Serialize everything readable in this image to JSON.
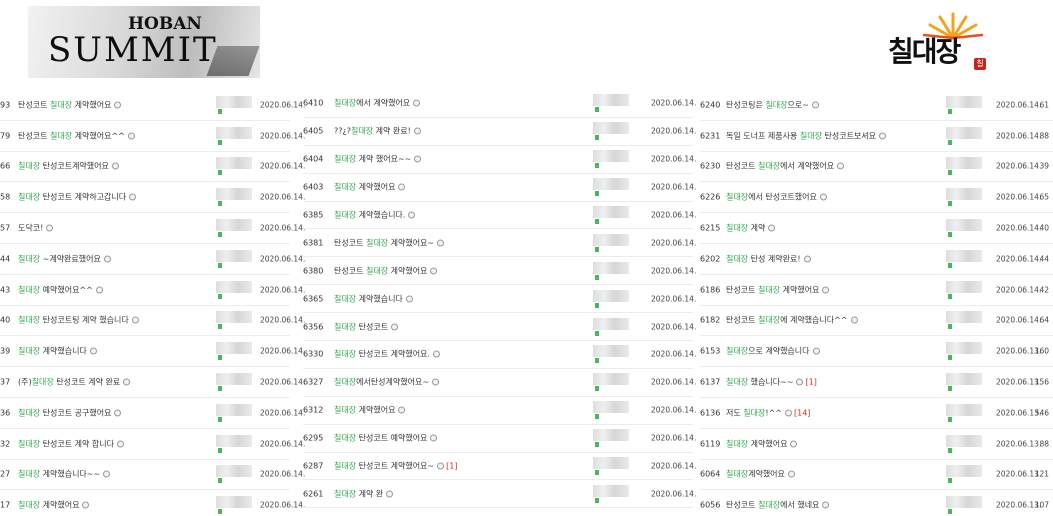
{
  "logos": {
    "left_top": "HOBAN",
    "left_bottom": "SUMMIT",
    "right": "칠대장",
    "right_seal": "칠"
  },
  "columns": [
    {
      "rows": [
        {
          "num": "93",
          "pre": "탄성코트 ",
          "hl": "칠대장",
          "post": " 계약했어요",
          "date": "2020.06.14."
        },
        {
          "num": "79",
          "pre": "탄성코트 ",
          "hl": "칠대장",
          "post": " 계약했어요^^",
          "date": "2020.06.14."
        },
        {
          "num": "66",
          "pre": "",
          "hl": "칠대장",
          "post": " 탄성코트계약했어요",
          "date": "2020.06.14."
        },
        {
          "num": "58",
          "pre": "",
          "hl": "칠대장",
          "post": " 탄성코트 계약하고갑니다",
          "date": "2020.06.14."
        },
        {
          "num": "57",
          "pre": "도닥코!",
          "hl": "",
          "post": "",
          "date": "2020.06.14."
        },
        {
          "num": "44",
          "pre": "",
          "hl": "칠대장",
          "post": " ~계약완료했어요",
          "date": "2020.06.14."
        },
        {
          "num": "43",
          "pre": "",
          "hl": "칠대장",
          "post": " 예약했어요^^",
          "date": "2020.06.14."
        },
        {
          "num": "40",
          "pre": "",
          "hl": "칠대장",
          "post": " 탄성코트팅 계약 했습니다",
          "date": "2020.06.14."
        },
        {
          "num": "39",
          "pre": "",
          "hl": "칠대장",
          "post": " 계약했습니다",
          "date": "2020.06.14."
        },
        {
          "num": "37",
          "pre": "(주)",
          "hl": "칠대장",
          "post": " 탄성코트 계약 완료",
          "date": "2020.06.14."
        },
        {
          "num": "36",
          "pre": "",
          "hl": "칠대장",
          "post": " 탄성코트 공구했어요",
          "date": "2020.06.14."
        },
        {
          "num": "32",
          "pre": "",
          "hl": "칠대장",
          "post": " 탄성코트 계약 합니다",
          "date": "2020.06.14."
        },
        {
          "num": "27",
          "pre": "",
          "hl": "칠대장",
          "post": " 계약했습니다~~",
          "date": "2020.06.14."
        },
        {
          "num": "17",
          "pre": "",
          "hl": "칠대장",
          "post": " 계약했어요",
          "date": "2020.06.14."
        }
      ]
    },
    {
      "rows": [
        {
          "num": "6410",
          "pre": "",
          "hl": "칠대장",
          "post": "에서 계약했어요",
          "date": "2020.06.14."
        },
        {
          "num": "6405",
          "pre": "??¿?",
          "hl": "칠대장",
          "post": " 계약 완료!",
          "date": "2020.06.14."
        },
        {
          "num": "6404",
          "pre": "",
          "hl": "칠대장",
          "post": " 계약 했어요~~",
          "date": "2020.06.14."
        },
        {
          "num": "6403",
          "pre": "",
          "hl": "칠대장",
          "post": " 계약했어요",
          "date": "2020.06.14."
        },
        {
          "num": "6385",
          "pre": "",
          "hl": "칠대장",
          "post": " 계약했습니다.",
          "date": "2020.06.14."
        },
        {
          "num": "6381",
          "pre": "탄성코트 ",
          "hl": "칠대장",
          "post": " 계약했어요~",
          "date": "2020.06.14."
        },
        {
          "num": "6380",
          "pre": "탄성코트 ",
          "hl": "칠대장",
          "post": " 계약했어요",
          "date": "2020.06.14."
        },
        {
          "num": "6365",
          "pre": "",
          "hl": "칠대장",
          "post": " 계약했습니다",
          "date": "2020.06.14."
        },
        {
          "num": "6356",
          "pre": "",
          "hl": "칠대장",
          "post": " 탄성코트",
          "date": "2020.06.14."
        },
        {
          "num": "6330",
          "pre": "",
          "hl": "칠대장",
          "post": " 탄성코트 계약했어요.",
          "date": "2020.06.14."
        },
        {
          "num": "6327",
          "pre": "",
          "hl": "칠대장",
          "post": "에서탄성계약했어요~",
          "date": "2020.06.14."
        },
        {
          "num": "6312",
          "pre": "",
          "hl": "칠대장",
          "post": " 계약했어요",
          "date": "2020.06.14."
        },
        {
          "num": "6295",
          "pre": "",
          "hl": "칠대장",
          "post": " 탄성코트 예약했어요",
          "date": "2020.06.14."
        },
        {
          "num": "6287",
          "pre": "",
          "hl": "칠대장",
          "post": " 탄성코트 계약했어요~",
          "cmt": "[1]",
          "date": "2020.06.14."
        },
        {
          "num": "6261",
          "pre": "",
          "hl": "칠대장",
          "post": " 계약 완",
          "date": "2020.06.14."
        }
      ]
    },
    {
      "rows": [
        {
          "num": "6240",
          "pre": "탄성코팅은 ",
          "hl": "칠대장",
          "post": "으로~",
          "date": "2020.06.14.",
          "views": "61"
        },
        {
          "num": "6231",
          "pre": "독일 도너프 제품사용 ",
          "hl": "칠대장",
          "post": " 탄성코트보셔요",
          "date": "2020.06.14.",
          "views": "88"
        },
        {
          "num": "6230",
          "pre": "탄성코트 ",
          "hl": "칠대장",
          "post": "에서 계약했어요",
          "date": "2020.06.14.",
          "views": "39"
        },
        {
          "num": "6226",
          "pre": "",
          "hl": "칠대장",
          "post": "에서 탄성코트했어요",
          "date": "2020.06.14.",
          "views": "65"
        },
        {
          "num": "6215",
          "pre": "",
          "hl": "칠대장",
          "post": " 계약",
          "date": "2020.06.14.",
          "views": "40"
        },
        {
          "num": "6202",
          "pre": "",
          "hl": "칠대장",
          "post": " 탄성 계약완료!",
          "date": "2020.06.14.",
          "views": "44"
        },
        {
          "num": "6186",
          "pre": "탄성코트 ",
          "hl": "칠대장",
          "post": " 계약했어요",
          "date": "2020.06.14.",
          "views": "42"
        },
        {
          "num": "6182",
          "pre": "탄성코트 ",
          "hl": "칠대장",
          "post": "에 계약했습니다^^",
          "date": "2020.06.14.",
          "views": "64"
        },
        {
          "num": "6153",
          "pre": "",
          "hl": "칠대장",
          "post": "으로 계약했습니다",
          "date": "2020.06.13.",
          "views": "160"
        },
        {
          "num": "6137",
          "pre": "",
          "hl": "칠대장",
          "post": " 했습니다~~",
          "cmt": "[1]",
          "date": "2020.06.13.",
          "views": "156"
        },
        {
          "num": "6136",
          "pre": "저도 ",
          "hl": "칠대장",
          "post": "!^^",
          "cmt": "[14]",
          "date": "2020.06.13.",
          "views": "546"
        },
        {
          "num": "6119",
          "pre": "",
          "hl": "칠대장",
          "post": " 계약했어요",
          "date": "2020.06.13.",
          "views": "88"
        },
        {
          "num": "6064",
          "pre": "",
          "hl": "칠대장",
          "post": "계약했어요",
          "date": "2020.06.13.",
          "views": "121"
        },
        {
          "num": "6056",
          "pre": "탄성코트 ",
          "hl": "칠대장",
          "post": "에서 했네요",
          "date": "2020.06.13.",
          "views": "107"
        }
      ]
    }
  ]
}
